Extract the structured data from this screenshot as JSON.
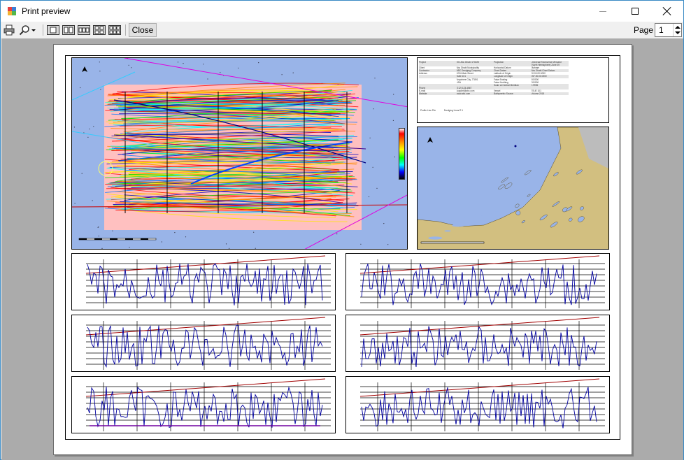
{
  "window": {
    "title": "Print preview",
    "controls": {
      "minimize_icon": "minimize-icon",
      "maximize_icon": "maximize-icon",
      "close_icon": "close-icon"
    }
  },
  "toolbar": {
    "print_icon": "printer-icon",
    "zoom_icon": "magnifier-icon",
    "zoom_dropdown_icon": "chevron-down-icon",
    "layout_icons": [
      "one-page-icon",
      "two-pages-icon",
      "three-pages-icon",
      "four-pages-icon",
      "six-pages-icon"
    ],
    "close_label": "Close",
    "page_label": "Page",
    "page_value": "1"
  },
  "sheet": {
    "info_table": [
      [
        "Project",
        "001 Abu Dhabi 170225",
        "Projection",
        "Universal Transverse Mercator"
      ],
      [
        "",
        "",
        "",
        "(North Hemisphere) Zone 39"
      ],
      [
        "Client",
        "Abu Dhabi Municipality",
        "Horizontal Datum",
        "Mahram"
      ],
      [
        "Contractor",
        "ABC Dredging Company",
        "Chart Datum",
        "Abu Dhabi Chart Datum"
      ],
      [
        "Address",
        "1234 Main Street",
        "Latitude of Origin",
        "00.00.00.0000"
      ],
      [
        "",
        "Suite 101",
        "Longitude of Origin",
        "057.00.00.0000"
      ],
      [
        "",
        "Anywhere City, 77891",
        "False Easting",
        "500000"
      ],
      [
        "",
        "USA",
        "False Northing",
        "000000"
      ],
      [
        "",
        "",
        "Scale at Central Meridian",
        "0.9996"
      ],
      [
        "Phone",
        "(212) 123-4567",
        "",
        ""
      ],
      [
        "E-mail",
        "support@abc.com",
        "Vessel",
        "TB-IE 101"
      ],
      [
        "Website",
        "www.abc.com",
        "Bathymetric Source",
        "Volume 2018"
      ]
    ],
    "profile_line_file_label": "Profile Line File",
    "profile_line_file_value": "Dredging Lines R 1",
    "depth_legend_colors": [
      "#ffffff",
      "#ff0000",
      "#ff9900",
      "#ffff00",
      "#00ff00",
      "#00ffff",
      "#0000ff",
      "#000000"
    ]
  }
}
